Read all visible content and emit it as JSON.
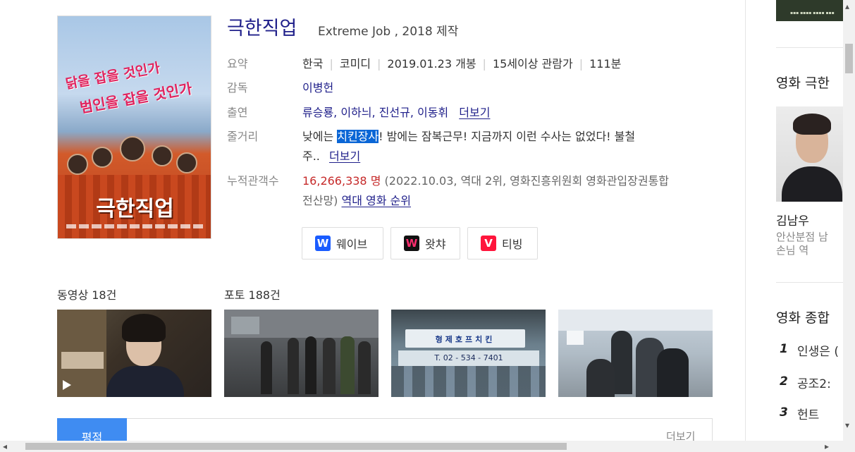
{
  "movie": {
    "title": "극한직업",
    "subtitle": "Extreme Job , 2018 제작",
    "poster": {
      "tagline1": "닭을 잡을 것인가",
      "tagline2": "범인을 잡을 것인가",
      "title": "극한직업"
    },
    "summary_label": "요약",
    "summary": [
      "한국",
      "코미디",
      "2019.01.23 개봉",
      "15세이상 관람가",
      "111분"
    ],
    "director_label": "감독",
    "director": "이병헌",
    "cast_label": "출연",
    "cast": "류승룡, 이하늬, 진선규, 이동휘",
    "more": "더보기",
    "plot_label": "줄거리",
    "plot_pre": "낮에는 ",
    "plot_highlight": "치킨장사",
    "plot_post": "! 밤에는 잠복근무! 지금까지 이런 수사는 없었다! 불철",
    "plot_line2": "주..",
    "audience_label": "누적관객수",
    "audience_count": "16,266,338 명",
    "audience_note1": "(2022.10.03, 역대 2위, 영화진흥위원회 영화관입장권통합",
    "audience_note2": "전산망)",
    "audience_rank_link": "역대 영화 순위"
  },
  "ott": [
    {
      "name": "웨이브",
      "icon": "wavve-icon",
      "logo": "W",
      "color": "#1a5cff"
    },
    {
      "name": "왓챠",
      "icon": "watcha-icon",
      "logo": "W",
      "color": "#111111"
    },
    {
      "name": "티빙",
      "icon": "tving-icon",
      "logo": "V",
      "color": "#ff153c"
    }
  ],
  "media": {
    "video_label": "동영상 18건",
    "photo_label": "포토 188건",
    "photo_sign": "형제호프치킨",
    "photo_phone": "T. 02 - 534 - 7401"
  },
  "tabs": {
    "active": "평점",
    "more": "더보기"
  },
  "sidebar": {
    "heading1": "영화 극한",
    "actor_name": "김남우",
    "actor_role1": "안산분점 남",
    "actor_role2": "손님 역",
    "heading2": "영화 종합",
    "ranking": [
      {
        "rank": "1",
        "title": "인생은 ("
      },
      {
        "rank": "2",
        "title": "공조2: "
      },
      {
        "rank": "3",
        "title": "헌트"
      }
    ]
  }
}
